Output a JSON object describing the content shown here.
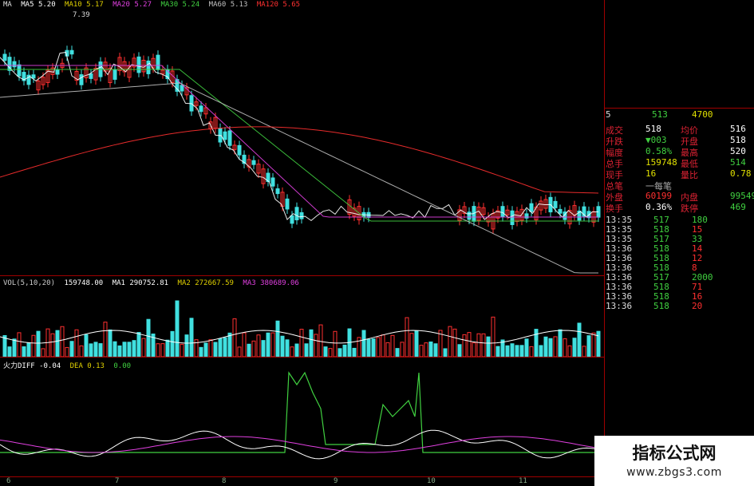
{
  "ma_legend": [
    {
      "text": "MA",
      "color": "#dddddd"
    },
    {
      "text": "MA5 5.20",
      "color": "#ffffff"
    },
    {
      "text": "MA10 5.17",
      "color": "#e0d000"
    },
    {
      "text": "MA20 5.27",
      "color": "#e040e0"
    },
    {
      "text": "MA30 5.24",
      "color": "#40d040"
    },
    {
      "text": "MA60 5.13",
      "color": "#c0c0c0"
    },
    {
      "text": "MA120 5.65",
      "color": "#ff3030"
    }
  ],
  "peak_label": "7.39",
  "vol_legend": [
    {
      "text": "VOL(5,10,20)",
      "color": "#cccccc"
    },
    {
      "text": "159748.00",
      "color": "#ffffff"
    },
    {
      "text": "MA1 290752.81",
      "color": "#ffffff"
    },
    {
      "text": "MA2 272667.59",
      "color": "#e0d000"
    },
    {
      "text": "MA3 380689.06",
      "color": "#e040e0"
    }
  ],
  "macd_legend": [
    {
      "text": "火力DIFF -0.04",
      "color": "#ffffff"
    },
    {
      "text": "DEA 0.13",
      "color": "#e0d000"
    },
    {
      "text": "0.00",
      "color": "#40d040"
    }
  ],
  "quote": {
    "head_left": "5",
    "head_mid": "513",
    "head_right": "4700",
    "rows": [
      {
        "l1": "成交",
        "v1": "518",
        "l2": "均价",
        "v2": "516",
        "c1": "#ffffff",
        "c2": "#ffffff"
      },
      {
        "l1": "升跌",
        "v1": "▼003",
        "l2": "开盘",
        "v2": "518",
        "c1": "#40d040",
        "c2": "#ffffff"
      },
      {
        "l1": "幅度",
        "v1": "0.58%",
        "l2": "最高",
        "v2": "520",
        "c1": "#40d040",
        "c2": "#ffffff"
      },
      {
        "l1": "总手",
        "v1": "159748",
        "l2": "最低",
        "v2": "514",
        "c1": "#e0e000",
        "c2": "#40d040"
      },
      {
        "l1": "现手",
        "v1": "16",
        "l2": "量比",
        "v2": "0.78",
        "c1": "#e0e000",
        "c2": "#e0e000"
      },
      {
        "l1": "总笔",
        "v1": "一每笔",
        "l2": "",
        "v2": "",
        "c1": "#aaaaaa",
        "c2": "#ffffff"
      },
      {
        "l1": "外盘",
        "v1": "60199",
        "l2": "内盘",
        "v2": "99549",
        "c1": "#ff3030",
        "c2": "#40d040"
      },
      {
        "l1": "换手",
        "v1": "0.36%",
        "l2": "跌停",
        "v2": "469",
        "c1": "#ffffff",
        "c2": "#40d040"
      }
    ],
    "ticks": [
      {
        "time": "13:35",
        "price": "517",
        "vol": "180",
        "vc": "#40d040"
      },
      {
        "time": "13:35",
        "price": "518",
        "vol": "15",
        "vc": "#ff3030"
      },
      {
        "time": "13:35",
        "price": "517",
        "vol": "33",
        "vc": "#40d040"
      },
      {
        "time": "13:36",
        "price": "518",
        "vol": "14",
        "vc": "#ff3030"
      },
      {
        "time": "13:36",
        "price": "518",
        "vol": "12",
        "vc": "#ff3030"
      },
      {
        "time": "13:36",
        "price": "518",
        "vol": "8",
        "vc": "#ff3030"
      },
      {
        "time": "13:36",
        "price": "517",
        "vol": "2000",
        "vc": "#40d040"
      },
      {
        "time": "13:36",
        "price": "518",
        "vol": "71",
        "vc": "#ff3030"
      },
      {
        "time": "13:36",
        "price": "518",
        "vol": "16",
        "vc": "#ff3030"
      },
      {
        "time": "13:36",
        "price": "518",
        "vol": "20",
        "vc": "#ff3030"
      }
    ]
  },
  "x_ticks": [
    "6",
    "7",
    "8",
    "9",
    "10",
    "11"
  ],
  "watermark": {
    "title": "指标公式网",
    "url": "www.zbgs3.com"
  },
  "colors": {
    "up": "#ff3030",
    "down": "#40e0e0",
    "grid": "#a00000"
  }
}
